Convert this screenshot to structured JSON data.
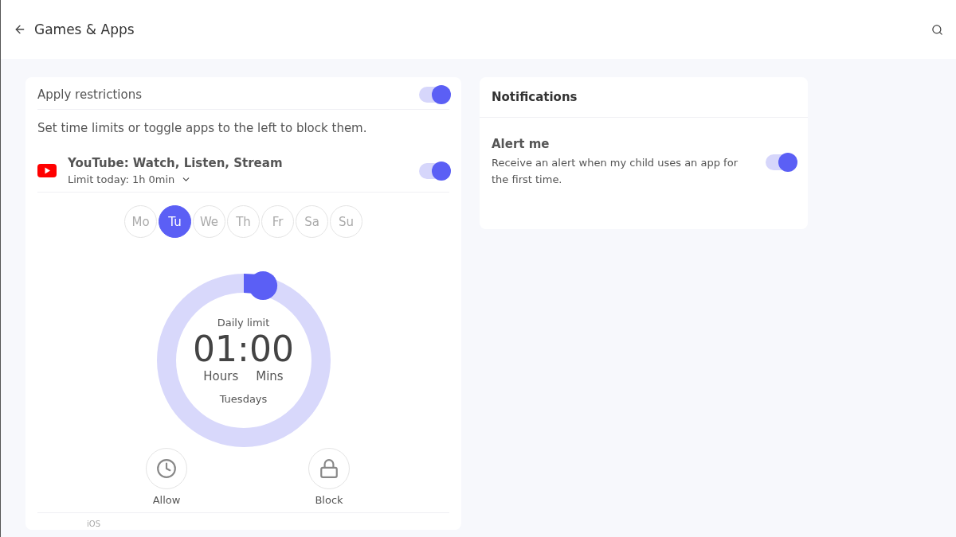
{
  "header": {
    "title": "Games & Apps"
  },
  "restrictions": {
    "label": "Apply restrictions",
    "on": true,
    "hint": "Set time limits or toggle apps to the left to block them.",
    "app": {
      "name": "YouTube: Watch, Listen, Stream",
      "limit": "Limit today: 1h 0min",
      "on": true
    },
    "days": [
      {
        "label": "Mo",
        "selected": false
      },
      {
        "label": "Tu",
        "selected": true
      },
      {
        "label": "We",
        "selected": false
      },
      {
        "label": "Th",
        "selected": false
      },
      {
        "label": "Fr",
        "selected": false
      },
      {
        "label": "Sa",
        "selected": false
      },
      {
        "label": "Su",
        "selected": false
      }
    ],
    "dial": {
      "caption": "Daily limit",
      "time": "01:00",
      "unit_hours": "Hours",
      "unit_mins": "Mins",
      "day": "Tuesdays",
      "level": 0.04
    },
    "actions": [
      {
        "kind": "allow",
        "label": "Allow"
      },
      {
        "kind": "block",
        "label": "Block"
      }
    ],
    "platform": "iOS"
  },
  "notifications": {
    "title": "Notifications",
    "alert": {
      "title": "Alert me",
      "text": "Receive an alert when my child uses an app for the first time.",
      "on": true
    }
  }
}
